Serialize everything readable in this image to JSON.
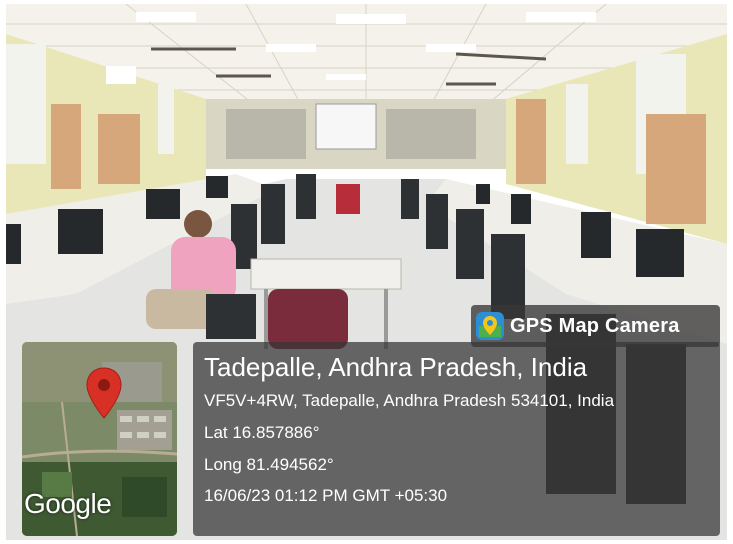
{
  "badge": {
    "label": "GPS Map Camera",
    "icon": "gps-map-camera-app-icon"
  },
  "location": {
    "title": "Tadepalle, Andhra Pradesh, India",
    "address": "VF5V+4RW, Tadepalle, Andhra Pradesh 534101, India",
    "lat": "Lat 16.857886°",
    "long": "Long 81.494562°",
    "datetime": "16/06/23 01:12 PM GMT +05:30"
  },
  "map": {
    "provider": "Google",
    "marker_icon": "map-pin-icon",
    "marker_color": "#d93025"
  },
  "colors": {
    "overlay_bg": "#373737",
    "wall": "#e9e7b8",
    "floor": "#e4e4e2",
    "desk": "#efeee9"
  }
}
